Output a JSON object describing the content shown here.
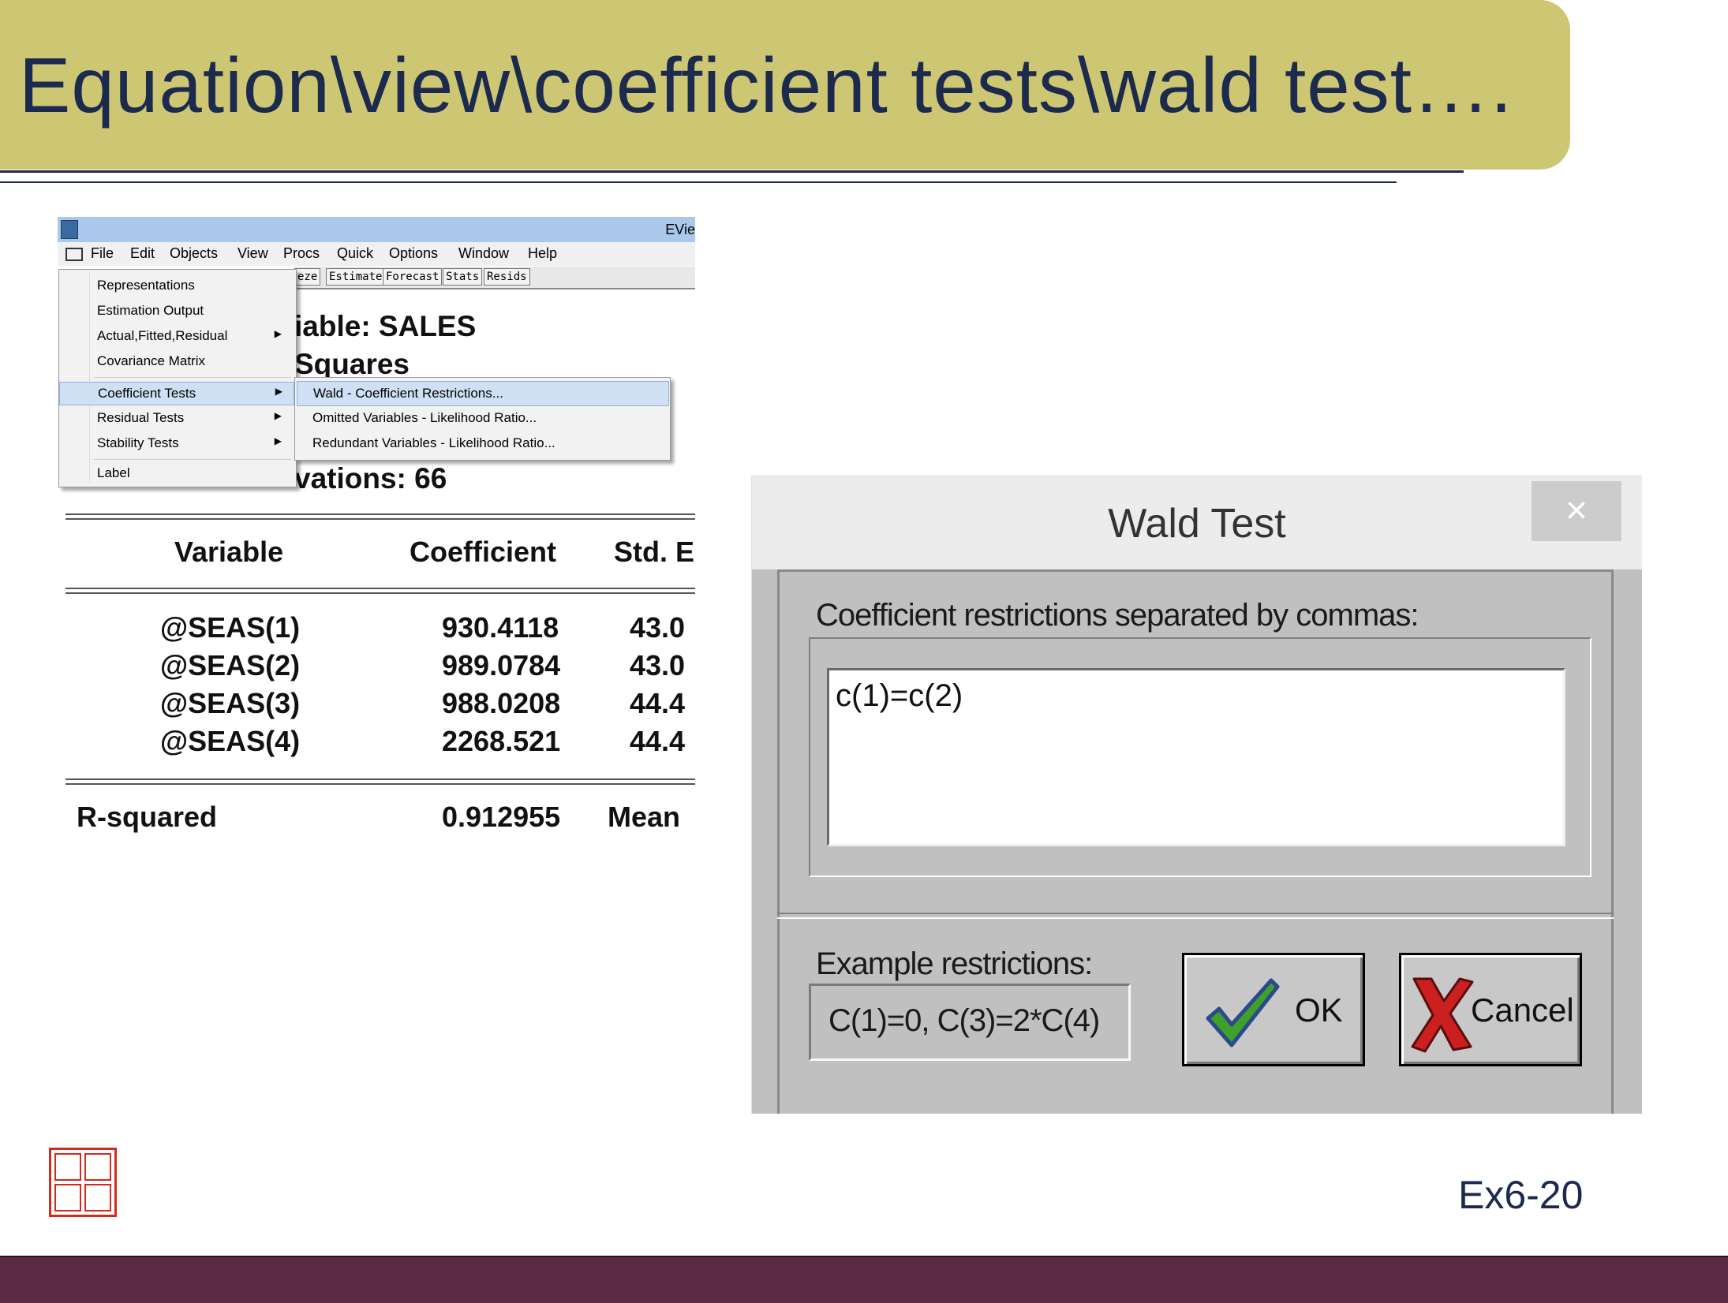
{
  "slide": {
    "title": "Equation\\view\\coefficient tests\\wald test….",
    "number": "Ex6-20"
  },
  "eviews": {
    "app_title": "EVie",
    "menubar": [
      "File",
      "Edit",
      "Objects",
      "View",
      "Procs",
      "Quick",
      "Options",
      "Window",
      "Help"
    ],
    "toolbar": [
      "eze",
      "Estimate",
      "Forecast",
      "Stats",
      "Resids"
    ],
    "view_menu": {
      "items": [
        {
          "label": "Representations",
          "submenu": false
        },
        {
          "label": "Estimation Output",
          "submenu": false
        },
        {
          "label": "Actual,Fitted,Residual",
          "submenu": true
        },
        {
          "label": "Covariance Matrix",
          "submenu": false
        },
        {
          "label": "Coefficient Tests",
          "submenu": true,
          "highlighted": true
        },
        {
          "label": "Residual Tests",
          "submenu": true
        },
        {
          "label": "Stability Tests",
          "submenu": true
        },
        {
          "label": "Label",
          "submenu": false
        }
      ]
    },
    "coef_submenu": [
      {
        "label": "Wald - Coefficient Restrictions...",
        "highlighted": true
      },
      {
        "label": "Omitted Variables - Likelihood Ratio..."
      },
      {
        "label": "Redundant Variables - Likelihood Ratio..."
      }
    ],
    "output": {
      "dep_var": "iable: SALES",
      "method": "Squares",
      "observations": "vations: 66",
      "headers": [
        "Variable",
        "Coefficient",
        "Std. E"
      ],
      "rows": [
        {
          "variable": "@SEAS(1)",
          "coef": "930.4118",
          "se": "43.0"
        },
        {
          "variable": "@SEAS(2)",
          "coef": "989.0784",
          "se": "43.0"
        },
        {
          "variable": "@SEAS(3)",
          "coef": "988.0208",
          "se": "44.4"
        },
        {
          "variable": "@SEAS(4)",
          "coef": "2268.521",
          "se": "44.4"
        }
      ],
      "stats": [
        {
          "label": "R-squared",
          "value": "0.912955",
          "right": "Mean"
        }
      ]
    }
  },
  "wald_dialog": {
    "title": "Wald Test",
    "close_glyph": "×",
    "prompt": "Coefficient restrictions separated by commas:",
    "restriction_value": "c(1)=c(2)",
    "example_label": "Example restrictions:",
    "example_text": "C(1)=0, C(3)=2*C(4)",
    "ok_label": "OK",
    "cancel_label": "Cancel",
    "colors": {
      "check_green": "#3fa12a",
      "check_blue": "#2b4a8a",
      "x_red": "#cc1f1f"
    }
  },
  "icons": [
    "eviews-app-icon",
    "system-menu-icon",
    "submenu-arrow-icon",
    "close-icon",
    "checkmark-icon",
    "red-x-icon",
    "seal-logo"
  ]
}
